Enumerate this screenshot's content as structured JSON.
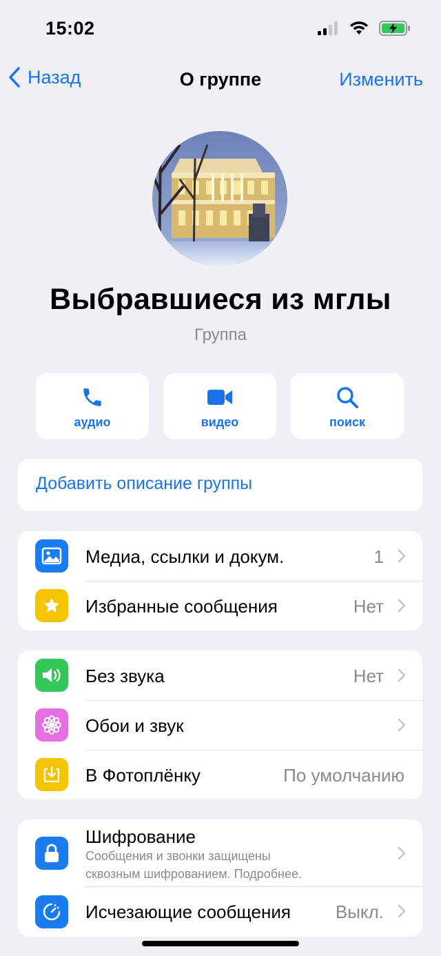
{
  "status": {
    "time": "15:02"
  },
  "nav": {
    "back_label": "Назад",
    "title": "О группе",
    "edit_label": "Изменить"
  },
  "group": {
    "name": "Выбравшиеся из мглы",
    "type": "Группа"
  },
  "actions": [
    {
      "label": "аудио",
      "icon": "phone-icon"
    },
    {
      "label": "видео",
      "icon": "video-camera-icon"
    },
    {
      "label": "поиск",
      "icon": "search-icon"
    }
  ],
  "description": {
    "label": "Добавить описание группы"
  },
  "section1": [
    {
      "title": "Медиа, ссылки и докум.",
      "value": "1",
      "icon": "photo-icon",
      "color": "#1a7cf0"
    },
    {
      "title": "Избранные сообщения",
      "value": "Нет",
      "icon": "star-icon",
      "color": "#f6c300"
    }
  ],
  "section2": [
    {
      "title": "Без звука",
      "value": "Нет",
      "icon": "speaker-icon",
      "color": "#34c759"
    },
    {
      "title": "Обои и звук",
      "value": "",
      "icon": "flower-icon",
      "color": "#e46fe0"
    },
    {
      "title": "В Фотоплёнку",
      "value": "По умолчанию",
      "icon": "save-to-photos-icon",
      "color": "#f6c300"
    }
  ],
  "section3": [
    {
      "title": "Шифрование",
      "subtitle_line1": "Сообщения и звонки защищены",
      "subtitle_line2": "сквозным шифрованием. Подробнее.",
      "icon": "lock-icon",
      "color": "#1a7cf0"
    },
    {
      "title": "Исчезающие сообщения",
      "value": "Выкл.",
      "icon": "timer-icon",
      "color": "#1a7cf0"
    }
  ]
}
